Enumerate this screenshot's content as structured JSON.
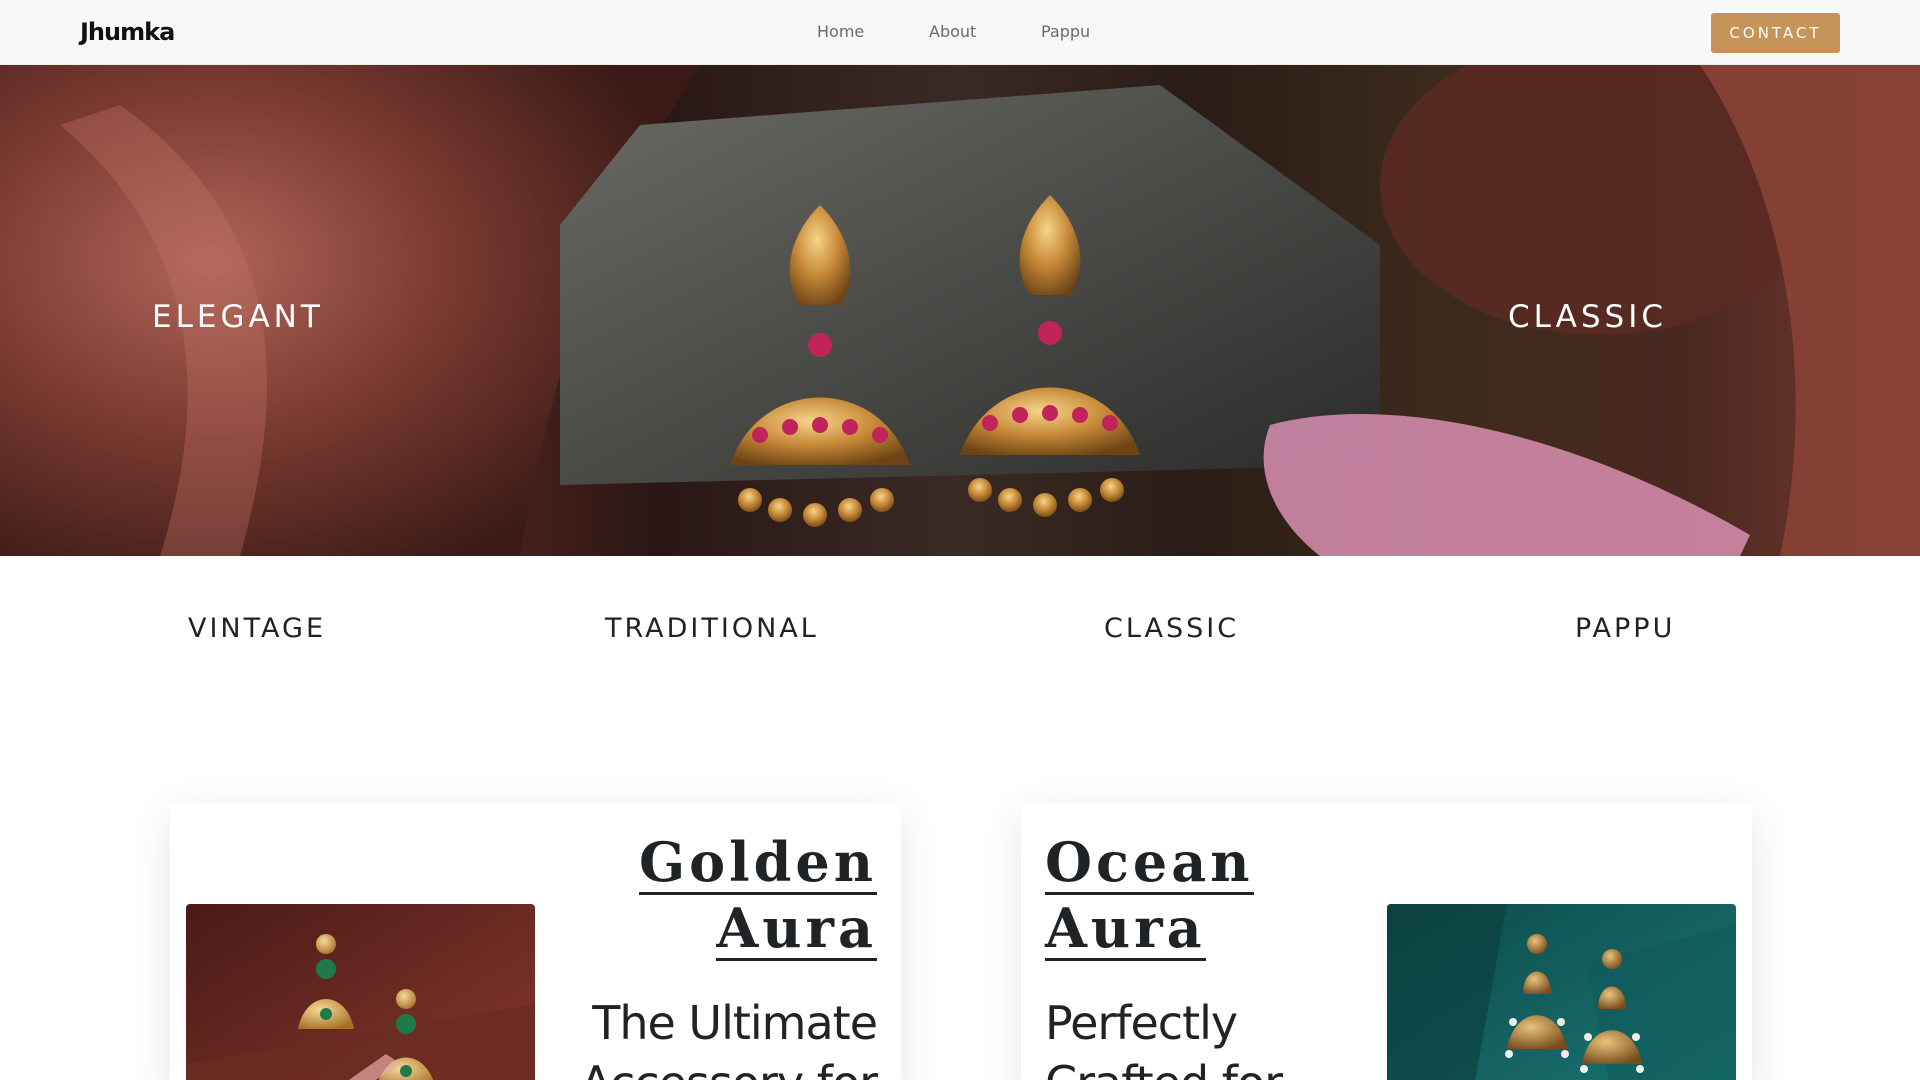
{
  "nav": {
    "brand": "Jhumka",
    "links": [
      "Home",
      "About",
      "Pappu"
    ],
    "contact_label": "CONTACT"
  },
  "hero": {
    "left_word": "Elegant",
    "right_word": "Classic"
  },
  "words": [
    "Vintage",
    "Traditional",
    "Classic",
    "Pappu"
  ],
  "cards": [
    {
      "title_line1": "Golden",
      "title_line2": "Aura",
      "subtitle_line1": "The Ultimate",
      "subtitle_line2": "Accessory for"
    },
    {
      "title_line1": "Ocean",
      "title_line2": "Aura",
      "subtitle_line1": "Perfectly",
      "subtitle_line2": "Crafted for"
    }
  ],
  "colors": {
    "accent": "#c69358",
    "text": "#1f2326",
    "nav_bg": "#f8f8f8"
  },
  "icons": [
    "hero-earrings-image",
    "golden-earrings-image",
    "ocean-earrings-image"
  ]
}
